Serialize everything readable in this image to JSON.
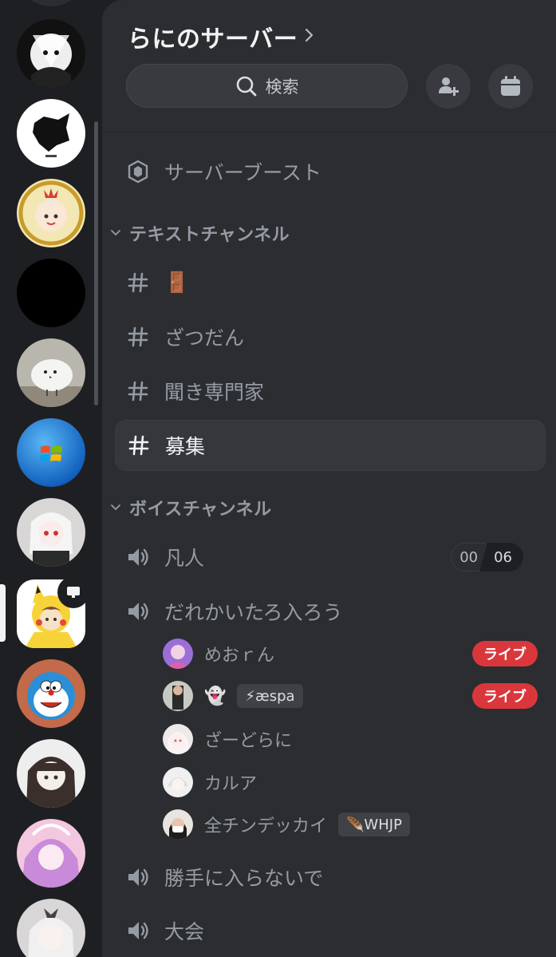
{
  "server": {
    "name": "らにのサーバー",
    "search_label": "検索"
  },
  "boost": {
    "label": "サーバーブースト"
  },
  "categories": {
    "text": "テキストチャンネル",
    "voice": "ボイスチャンネル"
  },
  "text_channels": [
    {
      "label": "🚪"
    },
    {
      "label": "ざつだん"
    },
    {
      "label": "聞き専門家"
    },
    {
      "label": "募集"
    }
  ],
  "voice_channels": [
    {
      "label": "凡人",
      "count_a": "00",
      "count_b": "06"
    },
    {
      "label": "だれかいたろ入ろう"
    },
    {
      "label": "勝手に入らないで"
    },
    {
      "label": "大会"
    }
  ],
  "voice_users": [
    {
      "name": "めおｒん",
      "live": "ライブ"
    },
    {
      "name": "👻",
      "tag": "⚡æspa",
      "live": "ライブ"
    },
    {
      "name": "ざーどらに"
    },
    {
      "name": "カルア"
    },
    {
      "name": "全チンデッカイ",
      "tag": "🪶WHJP"
    }
  ],
  "colors": {
    "rail_bg": "#1e1f22",
    "panel_bg": "#2b2d31",
    "live_red": "#da373c",
    "muted_text": "#949ba4"
  }
}
